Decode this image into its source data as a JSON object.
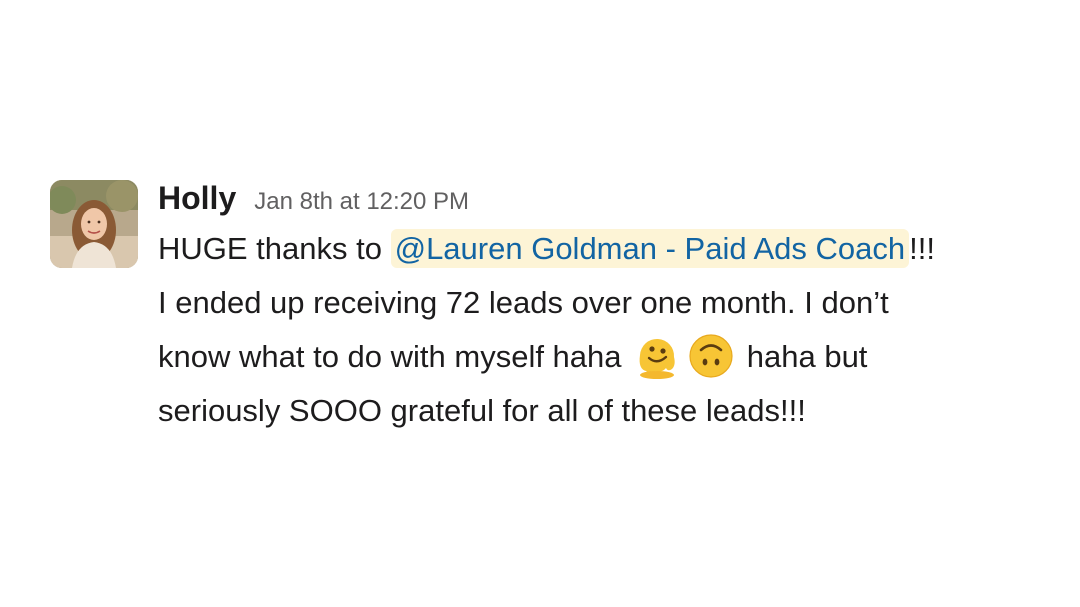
{
  "message": {
    "sender": "Holly",
    "timestamp": "Jan 8th at 12:20 PM",
    "line1_before": "HUGE thanks to ",
    "mention": "@Lauren Goldman - Paid Ads Coach",
    "line1_after": "!!!",
    "line2": "I ended up receiving 72 leads over one month. I don’t",
    "line3_before": "know what to do with myself haha ",
    "line3_after": " haha but",
    "line4": "seriously SOOO grateful for all of these leads!!!",
    "emojis": [
      "melting-face-emoji",
      "upside-down-face-emoji"
    ]
  },
  "colors": {
    "mention_bg": "#fdf4d6",
    "mention_text": "#1264a3",
    "timestamp": "#616061",
    "text": "#1d1c1d"
  }
}
